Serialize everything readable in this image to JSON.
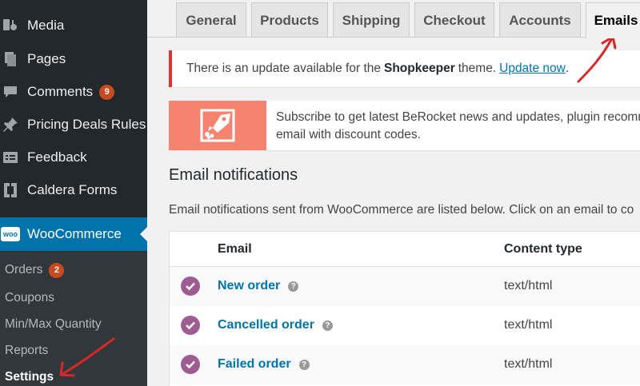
{
  "sidebar": {
    "items": [
      {
        "label": "Media",
        "icon": "media-icon"
      },
      {
        "label": "Pages",
        "icon": "pages-icon"
      },
      {
        "label": "Comments",
        "icon": "comments-icon",
        "badge": "9"
      },
      {
        "label": "Pricing Deals Rules",
        "icon": "pin-icon"
      },
      {
        "label": "Feedback",
        "icon": "feedback-icon"
      },
      {
        "label": "Caldera Forms",
        "icon": "caldera-icon"
      }
    ],
    "woocommerce": {
      "label": "WooCommerce",
      "logo_text": "woo"
    },
    "submenu": [
      {
        "label": "Orders",
        "badge": "2"
      },
      {
        "label": "Coupons"
      },
      {
        "label": "Min/Max Quantity"
      },
      {
        "label": "Reports"
      },
      {
        "label": "Settings"
      }
    ]
  },
  "tabs": [
    "General",
    "Products",
    "Shipping",
    "Checkout",
    "Accounts",
    "Emails"
  ],
  "active_tab": "Emails",
  "notice": {
    "prefix": "There is an update available for the",
    "theme": "Shopkeeper",
    "suffix": "theme.",
    "link": "Update now",
    "end": "."
  },
  "promo": {
    "line1": "Subscribe to get latest BeRocket news and updates, plugin recomm",
    "line2": "email with discount codes."
  },
  "section": {
    "title": "Email notifications",
    "description": "Email notifications sent from WooCommerce are listed below. Click on an email to co"
  },
  "table": {
    "headers": {
      "email": "Email",
      "content_type": "Content type"
    },
    "rows": [
      {
        "name": "New order",
        "content_type": "text/html"
      },
      {
        "name": "Cancelled order",
        "content_type": "text/html"
      },
      {
        "name": "Failed order",
        "content_type": "text/html"
      }
    ]
  },
  "colors": {
    "sidebar_bg": "#23282d",
    "accent": "#0073aa",
    "badge": "#ca4a1f",
    "notice_border": "#dc3232",
    "check": "#9e5c92",
    "annotation_arrow": "#d62828",
    "promo": "#f4846f"
  }
}
